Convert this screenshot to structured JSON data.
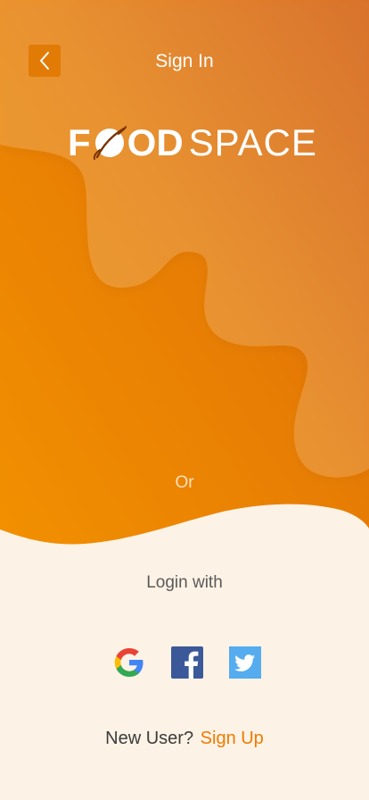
{
  "header": {
    "title": "Sign In"
  },
  "logo": {
    "bold": "FOOD",
    "light": "SPACE",
    "bold_first_letter": "F",
    "bold_rest": "OD"
  },
  "divider": {
    "or_label": "Or"
  },
  "social": {
    "heading": "Login with",
    "providers": [
      "google",
      "facebook",
      "twitter"
    ]
  },
  "footer": {
    "prompt": "New User?",
    "signup_label": "Sign Up"
  },
  "colors": {
    "primary_orange": "#EE7B00",
    "dark_orange": "#D45A00",
    "cream_background": "#FDF2E6",
    "back_button": "#E27B05",
    "facebook_blue": "#3B5998",
    "twitter_blue": "#55ACEE"
  },
  "icons": {
    "back": "chevron-left-icon",
    "google": "google-icon",
    "facebook": "facebook-icon",
    "twitter": "twitter-icon",
    "logo_mark": "planet-icon"
  }
}
